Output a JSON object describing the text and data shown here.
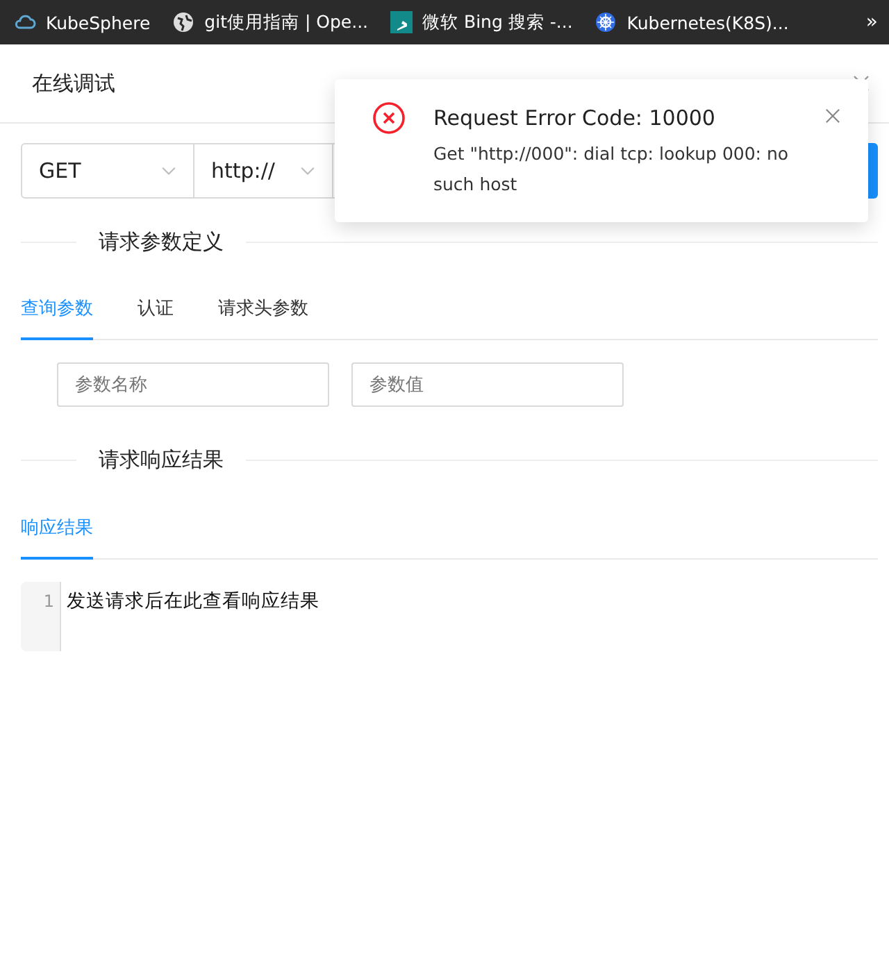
{
  "bookmarks": [
    {
      "kind": "cloud",
      "label": "KubeSphere"
    },
    {
      "kind": "globe",
      "label": "git使用指南 | Ope..."
    },
    {
      "kind": "bing",
      "label": "微软 Bing 搜索 -..."
    },
    {
      "kind": "wheel",
      "label": "Kubernetes(K8S)..."
    }
  ],
  "bookmarks_more": "»",
  "dialog": {
    "title": "在线调试"
  },
  "request": {
    "method": "GET",
    "protocol": "http://"
  },
  "param_section": {
    "title": "请求参数定义",
    "tabs": [
      {
        "label": "查询参数",
        "selected": true
      },
      {
        "label": "认证",
        "selected": false
      },
      {
        "label": "请求头参数",
        "selected": false
      }
    ],
    "fields": [
      {
        "placeholder": "参数名称"
      },
      {
        "placeholder": "参数值"
      }
    ]
  },
  "response_section": {
    "title": "请求响应结果",
    "tabs": [
      {
        "label": "响应结果",
        "selected": true
      }
    ],
    "editor": {
      "lines": [
        {
          "number": "1",
          "text": "发送请求后在此查看响应结果"
        }
      ]
    }
  },
  "notification": {
    "title": "Request Error Code: 10000",
    "message": "Get \"http://000\": dial tcp: lookup 000: no such host"
  }
}
